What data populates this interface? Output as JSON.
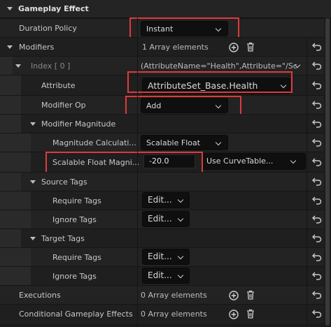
{
  "header": {
    "title": "Gameplay Effect"
  },
  "duration_policy": {
    "label": "Duration Policy",
    "value": "Instant"
  },
  "modifiers": {
    "label": "Modifiers",
    "count": "1 Array elements"
  },
  "index0": {
    "label": "Index [ 0 ]",
    "value": "(AttributeName=\"Health\",Attribute=\"/Sc"
  },
  "attribute": {
    "label": "Attribute",
    "value": "AttributeSet_Base.Health"
  },
  "modifier_op": {
    "label": "Modifier Op",
    "value": "Add"
  },
  "modifier_magnitude": {
    "label": "Modifier Magnitude"
  },
  "magnitude_calc": {
    "label": "Magnitude Calculati...",
    "value": "Scalable Float"
  },
  "scalable_float": {
    "label": "Scalable Float Magni...",
    "value": "-20.0",
    "curve": "Use CurveTable..."
  },
  "source_tags": {
    "label": "Source Tags"
  },
  "source_require": {
    "label": "Require Tags",
    "button": "Edit..."
  },
  "source_ignore": {
    "label": "Ignore Tags",
    "button": "Edit..."
  },
  "target_tags": {
    "label": "Target Tags"
  },
  "target_require": {
    "label": "Require Tags",
    "button": "Edit..."
  },
  "target_ignore": {
    "label": "Ignore Tags",
    "button": "Edit..."
  },
  "executions": {
    "label": "Executions",
    "count": "0 Array elements"
  },
  "conditional": {
    "label": "Conditional Gameplay Effects",
    "count": "0 Array elements"
  },
  "colors": {
    "highlight": "#e0393b",
    "panel": "#232323",
    "field": "#0f0f0f"
  },
  "icons": [
    "collapse-arrow-icon",
    "reset-arrow-icon",
    "add-element-icon",
    "trash-icon",
    "chevron-down-icon"
  ]
}
